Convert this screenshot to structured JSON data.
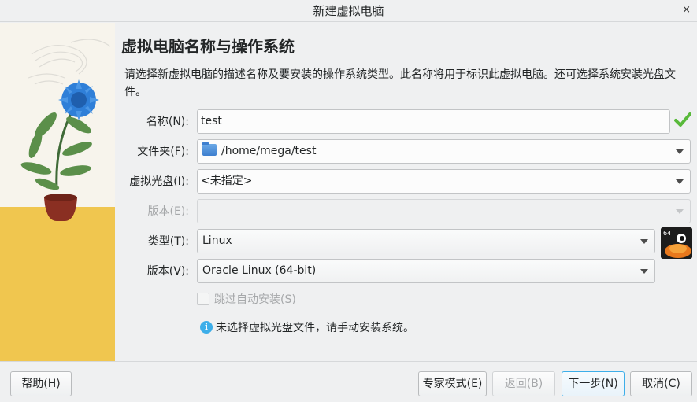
{
  "window": {
    "title": "新建虚拟电脑",
    "close_glyph": "×"
  },
  "page": {
    "heading": "虚拟电脑名称与操作系统",
    "description": "请选择新虚拟电脑的描述名称及要安装的操作系统类型。此名称将用于标识此虚拟电脑。还可选择系统安装光盘文件。"
  },
  "form": {
    "name": {
      "label": "名称(N):",
      "value": "test",
      "valid": true
    },
    "folder": {
      "label": "文件夹(F):",
      "value": "/home/mega/test"
    },
    "iso": {
      "label": "虚拟光盘(I):",
      "value": "<未指定>"
    },
    "edition": {
      "label": "版本(E):",
      "value": "",
      "disabled": true
    },
    "type": {
      "label": "类型(T):",
      "value": "Linux"
    },
    "version": {
      "label": "版本(V):",
      "value": "Oracle Linux (64-bit)"
    },
    "skip_unattended": {
      "label": "跳过自动安装(S)",
      "checked": false,
      "disabled": true
    },
    "info_text": "未选择虚拟光盘文件，请手动安装系统。",
    "os_badge": "64"
  },
  "buttons": {
    "help": "帮助(H)",
    "expert": "专家模式(E)",
    "back": "返回(B)",
    "next": "下一步(N)",
    "cancel": "取消(C)"
  },
  "colors": {
    "accent": "#3daee9",
    "valid_check": "#58b93a",
    "plant_flower": "#2f7fd8",
    "illustration_ground": "#f0c64f"
  }
}
